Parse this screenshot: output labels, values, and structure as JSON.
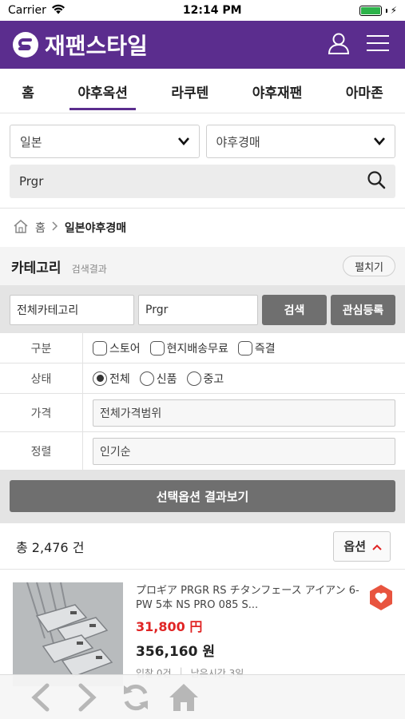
{
  "status_bar": {
    "carrier": "Carrier",
    "time": "12:14 PM"
  },
  "header": {
    "brand": "재팬스타일",
    "accent_color": "#5b2d8e"
  },
  "nav": {
    "tabs": [
      "홈",
      "야후옥션",
      "라쿠텐",
      "야후재팬",
      "아마존"
    ],
    "active_index": 1
  },
  "search": {
    "country_select": "일본",
    "site_select": "야후경매",
    "query": "Prgr"
  },
  "breadcrumb": {
    "home": "홈",
    "current": "일본야후경매"
  },
  "category": {
    "title": "카테고리",
    "subtitle": "검색결과",
    "expand_label": "펼치기"
  },
  "filter": {
    "category_value": "전체카테고리",
    "keyword_value": "Prgr",
    "search_label": "검색",
    "watch_label": "관심등록"
  },
  "options": {
    "type": {
      "label": "구분",
      "items": [
        "스토어",
        "현지배송무료",
        "즉결"
      ]
    },
    "condition": {
      "label": "상태",
      "items": [
        "전체",
        "신품",
        "중고"
      ],
      "selected": 0
    },
    "price": {
      "label": "가격",
      "value": "전체가격범위"
    },
    "sort": {
      "label": "정렬",
      "value": "인기순"
    },
    "apply_label": "선택옵션 결과보기"
  },
  "results": {
    "total_text": "총 2,476 건",
    "option_label": "옵션"
  },
  "products": [
    {
      "title": "プロギア PRGR RS チタンフェース アイアン 6-PW 5本 NS PRO 085 S...",
      "price_yen": "31,800 円",
      "price_won": "356,160 원",
      "bids": "입찰 0건",
      "time_left": "남은시간 3일"
    }
  ]
}
